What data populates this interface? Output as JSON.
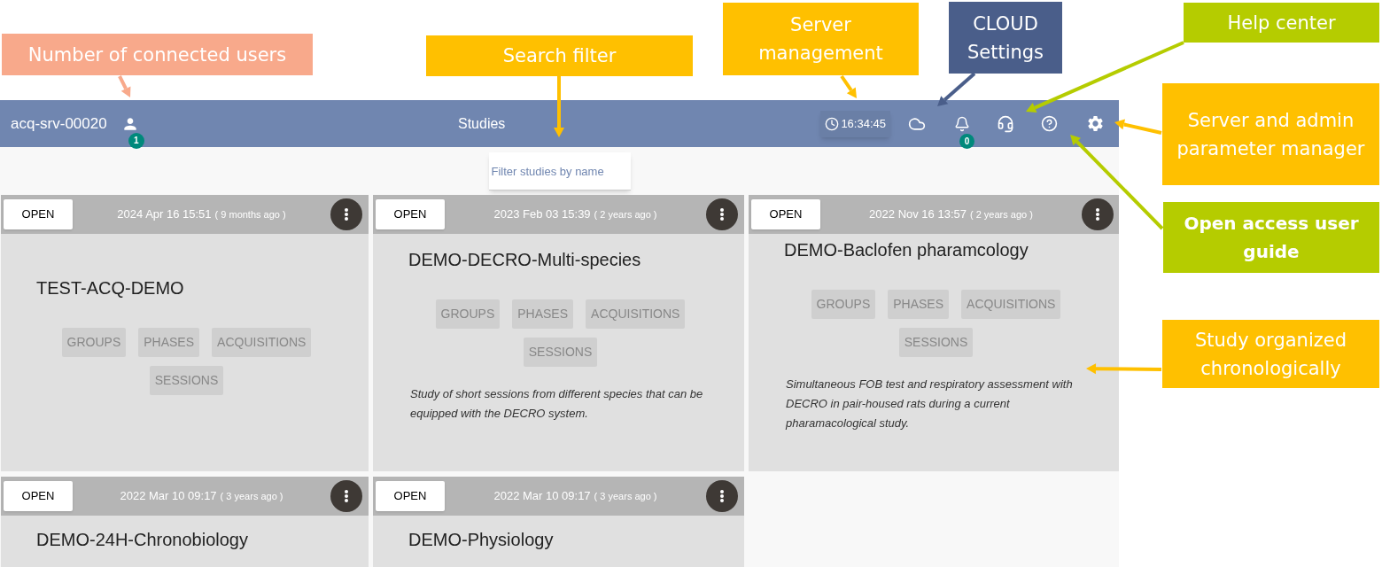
{
  "annotations": [
    {
      "text": "Number of connected users",
      "color": "#f8a98b",
      "bold": false
    },
    {
      "text": "Search filter",
      "color": "#ffc000",
      "bold": false
    },
    {
      "text": "Server management",
      "color": "#ffc000",
      "bold": false
    },
    {
      "text": "CLOUD Settings",
      "color": "#4a5e8a",
      "bold": false
    },
    {
      "text": "Help center",
      "color": "#b5cc00",
      "bold": false
    },
    {
      "text": "Server and admin parameter manager",
      "color": "#ffc000",
      "bold": false
    },
    {
      "text": "Open access user guide",
      "color": "#b5cc00",
      "bold": true
    },
    {
      "text": "Study organized chronologically",
      "color": "#ffc000",
      "bold": false
    }
  ],
  "app": {
    "server_name": "acq-srv-00020",
    "connected_users_badge": "1",
    "page_title": "Studies",
    "clock": "16:34:45",
    "notifications_badge": "0",
    "search": {
      "placeholder": "Filter studies by name"
    }
  },
  "studies": [
    {
      "open_label": "OPEN",
      "date": "2024 Apr 16 15:51",
      "age": "( 9 months ago )",
      "title": "TEST-ACQ-DEMO",
      "sections": [
        "GROUPS",
        "PHASES",
        "ACQUISITIONS",
        "SESSIONS"
      ]
    },
    {
      "open_label": "OPEN",
      "date": "2023 Feb 03 15:39",
      "age": "( 2 years ago )",
      "title": "DEMO-DECRO-Multi-species",
      "sections": [
        "GROUPS",
        "PHASES",
        "ACQUISITIONS",
        "SESSIONS"
      ],
      "description": "Study of short sessions from different species that can be equipped with the DECRO system."
    },
    {
      "open_label": "OPEN",
      "date": "2022 Nov 16 13:57",
      "age": "( 2 years ago )",
      "title": "DEMO-Baclofen pharamcology",
      "sections": [
        "GROUPS",
        "PHASES",
        "ACQUISITIONS",
        "SESSIONS"
      ],
      "description": "Simultaneous FOB test and respiratory assessment with DECRO in pair-housed rats during a current pharamacological study."
    },
    {
      "open_label": "OPEN",
      "date": "2022 Mar 10 09:17",
      "age": "( 3 years ago )",
      "title": "DEMO-24H-Chronobiology"
    },
    {
      "open_label": "OPEN",
      "date": "2022 Mar 10 09:17",
      "age": "( 3 years ago )",
      "title": "DEMO-Physiology"
    }
  ]
}
